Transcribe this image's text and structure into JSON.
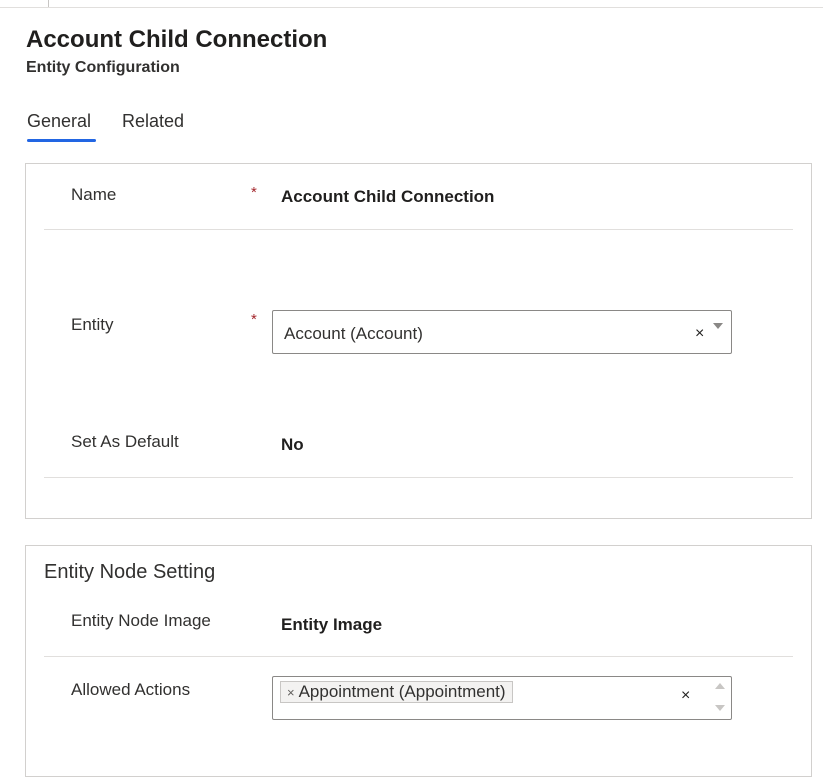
{
  "header": {
    "title": "Account Child Connection",
    "subtitle": "Entity Configuration"
  },
  "tabs": [
    {
      "label": "General",
      "active": true
    },
    {
      "label": "Related",
      "active": false
    }
  ],
  "general_section": {
    "name": {
      "label": "Name",
      "required_mark": "*",
      "value": "Account Child Connection"
    },
    "entity": {
      "label": "Entity",
      "required_mark": "*",
      "value": "Account (Account)",
      "clear_glyph": "×"
    },
    "set_as_default": {
      "label": "Set As Default",
      "value": "No"
    }
  },
  "entity_node_section": {
    "title": "Entity Node Setting",
    "node_image": {
      "label": "Entity Node Image",
      "value": "Entity Image"
    },
    "allowed_actions": {
      "label": "Allowed Actions",
      "tag_remove_glyph": "×",
      "tags": [
        "Appointment (Appointment)"
      ],
      "clear_glyph": "×"
    }
  },
  "colors": {
    "accent": "#2266e3",
    "required": "#a4262c",
    "border": "#d2d0ce"
  }
}
